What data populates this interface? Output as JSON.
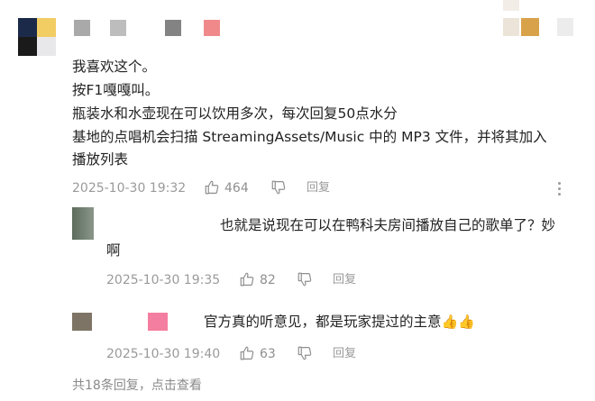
{
  "comment": {
    "lines": [
      "我喜欢这个。",
      "按F1嘎嘎叫。",
      "瓶装水和水壶现在可以饮用多次，每次回复50点水分",
      "基地的点唱机会扫描 StreamingAssets/Music 中的 MP3 文件，并将其加入",
      "播放列表"
    ],
    "timestamp": "2025-10-30 19:32",
    "likes": "464",
    "reply_label": "回复"
  },
  "replies": [
    {
      "line1": "也就是说现在可以在鸭科夫房间播放自己的歌单了？妙",
      "line2": "啊",
      "timestamp": "2025-10-30 19:35",
      "likes": "82",
      "reply_label": "回复"
    },
    {
      "text": "官方真的听意见，都是玩家提过的主意",
      "emoji": "👍👍",
      "timestamp": "2025-10-30 19:40",
      "likes": "63",
      "reply_label": "回复"
    }
  ],
  "footer": {
    "text": "共18条回复，点击查看"
  },
  "colors": {
    "meta_gray": "#9a9a9a",
    "avatar_dark": "#1f2a44",
    "avatar_yellow": "#f1c95a",
    "pink_block": "#f08a8a",
    "reply_pink": "#f47ea0",
    "tan_block": "#d9a550"
  }
}
